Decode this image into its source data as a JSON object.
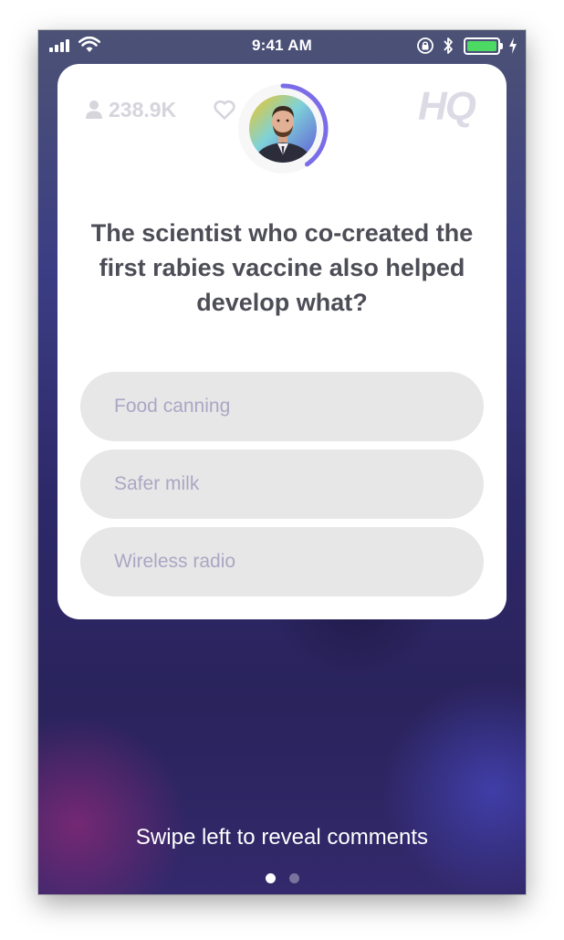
{
  "status_bar": {
    "time": "9:41 AM",
    "icons": [
      "signal-icon",
      "wifi-icon",
      "orientation-lock-icon",
      "bluetooth-icon",
      "battery-icon",
      "charging-icon"
    ],
    "battery_level": 1.0,
    "battery_color": "#4cd964"
  },
  "card": {
    "viewer_count": "238.9K",
    "viewer_icon": "person-icon",
    "heart_icon": "heart-icon",
    "logo": "HQ",
    "host_avatar": "host-avatar",
    "question": "The scientist who co-created the first rabies vaccine also helped develop what?",
    "answers": [
      {
        "label": "Food canning"
      },
      {
        "label": "Safer milk"
      },
      {
        "label": "Wireless radio"
      }
    ]
  },
  "footer": {
    "swipe_hint": "Swipe left to reveal comments",
    "page_count": 2,
    "active_page": 1
  },
  "colors": {
    "card_background": "#ffffff",
    "answer_background": "#e7e7e8",
    "answer_text": "#aaa7c3",
    "question_text": "#4d4d57",
    "timer_ring": "#7b6ce8",
    "background_top": "#4c5275",
    "background_bottom": "#2a235c"
  }
}
